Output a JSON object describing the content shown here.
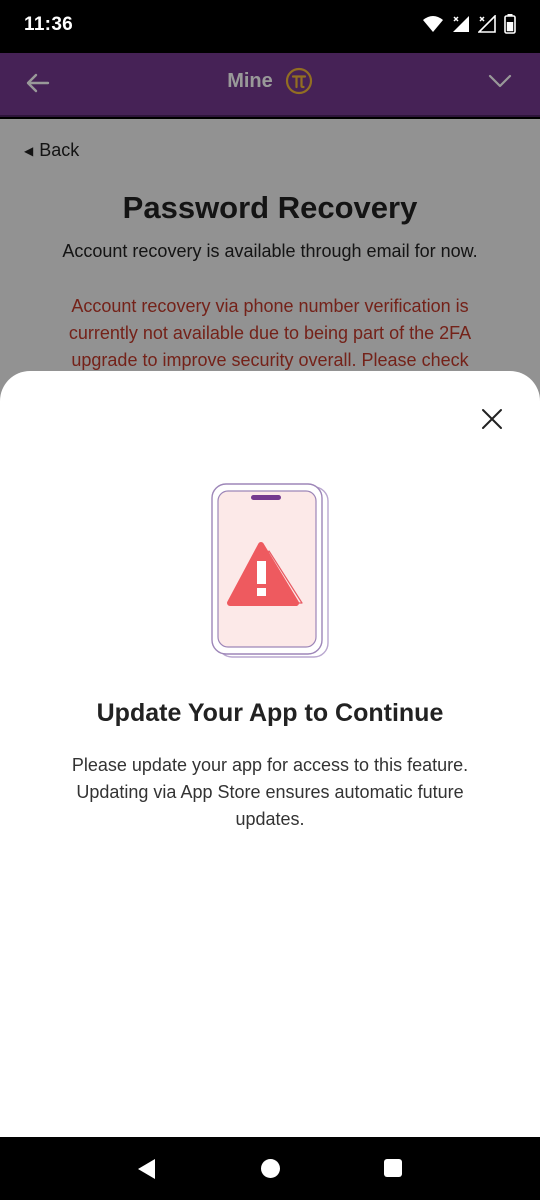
{
  "status_bar": {
    "time": "11:36",
    "icons": [
      "wifi-icon",
      "signal-icon",
      "signal-no-data-icon",
      "battery-icon"
    ]
  },
  "header": {
    "title": "Mine",
    "back_icon": "arrow-left-icon",
    "logo_icon": "pi-logo-icon",
    "menu_icon": "chevron-down-icon",
    "color": "#753A8F"
  },
  "page": {
    "back_label": "Back",
    "title": "Password Recovery",
    "info": "Account recovery is available through email for now.",
    "warning": "Account recovery via phone number verification is currently not available due to being part of the 2FA upgrade to improve security overall. Please check",
    "warning_color": "#c1392b"
  },
  "modal": {
    "close_icon": "close-icon",
    "illustration": "phone-warning-icon",
    "title": "Update Your App to Continue",
    "description": "Please update your app for access to this feature. Updating via App Store ensures automatic future updates."
  },
  "nav_bar": {
    "icons": [
      "nav-back-icon",
      "nav-home-icon",
      "nav-recents-icon"
    ]
  }
}
